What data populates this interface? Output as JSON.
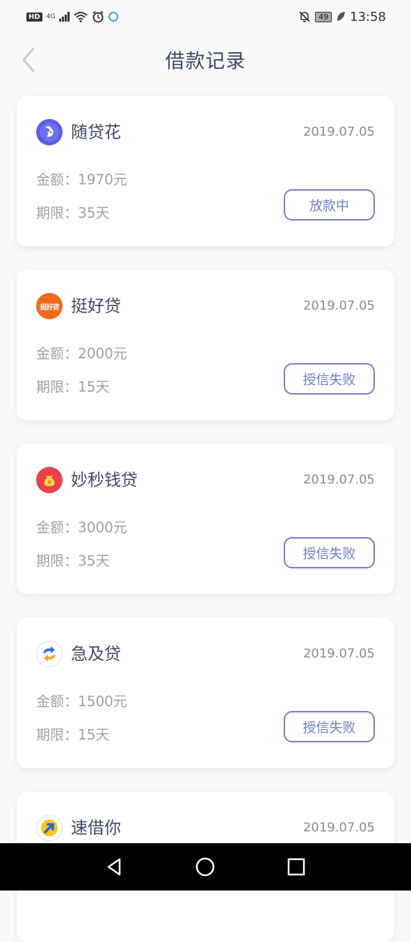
{
  "status_bar": {
    "hd": "HD",
    "network": "4G",
    "battery": "49",
    "time": "13:58"
  },
  "header": {
    "title": "借款记录"
  },
  "loans": [
    {
      "name": "随贷花",
      "date": "2019.07.05",
      "amount": "金额：1970元",
      "term": "期限：35天",
      "status": "放款中",
      "logo_icon": "rabbit-logo-icon",
      "logo_color": "#5b5ce8"
    },
    {
      "name": "挺好贷",
      "date": "2019.07.05",
      "amount": "金额：2000元",
      "term": "期限：15天",
      "status": "授信失败",
      "logo_icon": "tinghaodai-logo-icon",
      "logo_color": "#f46a1c",
      "logo_text": "挺好贷"
    },
    {
      "name": "妙秒钱贷",
      "date": "2019.07.05",
      "amount": "金额：3000元",
      "term": "期限：35天",
      "status": "授信失败",
      "logo_icon": "money-bag-logo-icon",
      "logo_color": "#e8424a"
    },
    {
      "name": "急及贷",
      "date": "2019.07.05",
      "amount": "金额：1500元",
      "term": "期限：15天",
      "status": "授信失败",
      "logo_icon": "exchange-logo-icon",
      "logo_color": "#2f6fd8"
    },
    {
      "name": "速借你",
      "date": "2019.07.05",
      "logo_icon": "arrow-logo-icon",
      "logo_color": "#f2c81c"
    }
  ],
  "colors": {
    "accent": "#6e7fc9",
    "title": "#3c4a6b"
  }
}
